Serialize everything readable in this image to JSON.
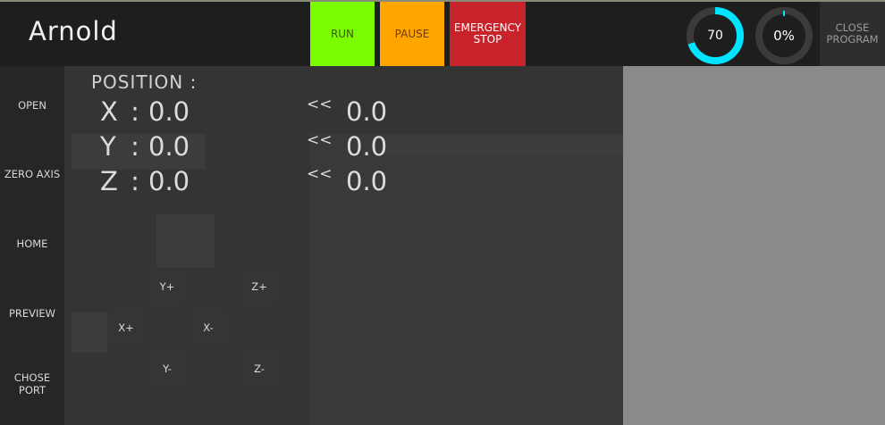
{
  "app": {
    "title": "Arnold"
  },
  "controls": {
    "run_label": "RUN",
    "pause_label": "PAUSE",
    "stop_label": "EMERGENCY\nSTOP",
    "colors": {
      "run": "#7cfc00",
      "pause": "#ffa500",
      "stop": "#c8232a",
      "gauge_accent": "#00e5ff"
    }
  },
  "gauges": {
    "speed": {
      "text": "70",
      "fraction": 0.7
    },
    "progress": {
      "text": "0%",
      "fraction": 0.0
    }
  },
  "close_label": "CLOSE\nPROGRAM",
  "sidebar": {
    "items": [
      {
        "label": "OPEN"
      },
      {
        "label": "ZERO AXIS"
      },
      {
        "label": "HOME"
      },
      {
        "label": "PREVIEW"
      },
      {
        "label": "CHOSE\nPORT"
      }
    ]
  },
  "position": {
    "title": "POSITION :",
    "rows": [
      {
        "axis": "X",
        "sep": ":",
        "value": "0.0",
        "arrow": "<<",
        "target": "0.0"
      },
      {
        "axis": "Y",
        "sep": ":",
        "value": "0.0",
        "arrow": "<<",
        "target": "0.0"
      },
      {
        "axis": "Z",
        "sep": ":",
        "value": "0.0",
        "arrow": "<<",
        "target": "0.0"
      }
    ]
  },
  "jog": {
    "y_plus": "Y+",
    "z_plus": "Z+",
    "x_plus": "X+",
    "x_minus": "X-",
    "y_minus": "Y-",
    "z_minus": "Z-"
  }
}
